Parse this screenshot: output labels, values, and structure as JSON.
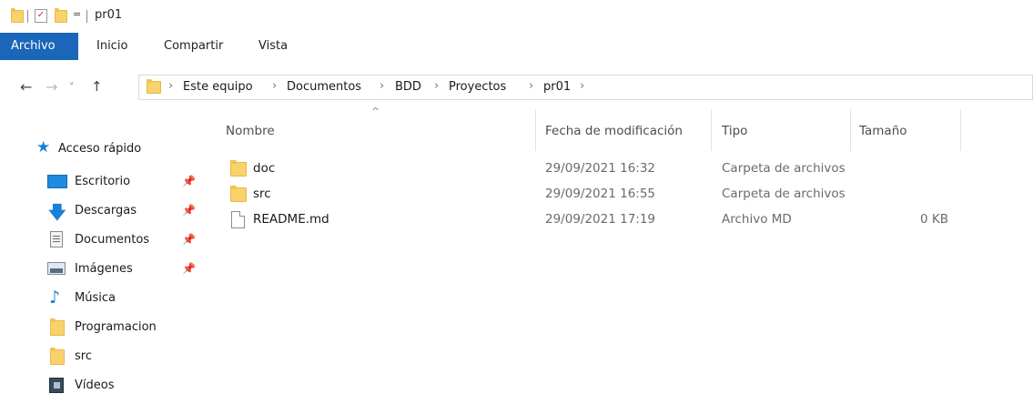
{
  "window": {
    "title": "pr01",
    "quick_access_dropdown": "="
  },
  "ribbon": {
    "tabs": [
      "Archivo",
      "Inicio",
      "Compartir",
      "Vista"
    ]
  },
  "address": {
    "back": "←",
    "forward": "→",
    "recent": "˅",
    "up": "↑",
    "separator": "›",
    "path": [
      "Este equipo",
      "Documentos",
      "BDD",
      "Proyectos",
      "pr01"
    ]
  },
  "sidebar": {
    "items": [
      {
        "label": "Acceso rápido",
        "icon": "star-icon",
        "color": "#1a7fd6"
      },
      {
        "label": "Escritorio",
        "icon": "desktop-icon",
        "pinned": true
      },
      {
        "label": "Descargas",
        "icon": "download-icon",
        "pinned": true
      },
      {
        "label": "Documentos",
        "icon": "document-icon",
        "pinned": true
      },
      {
        "label": "Imágenes",
        "icon": "image-icon",
        "pinned": true
      },
      {
        "label": "Música",
        "icon": "music-icon"
      },
      {
        "label": "Programacion",
        "icon": "folder-icon"
      },
      {
        "label": "src",
        "icon": "folder-icon"
      },
      {
        "label": "Vídeos",
        "icon": "video-icon"
      }
    ]
  },
  "file_list": {
    "columns": [
      "Nombre",
      "Fecha de modificación",
      "Tipo",
      "Tamaño"
    ],
    "sort_indicator": "^",
    "rows": [
      {
        "name": "doc",
        "modified": "29/09/2021 16:32",
        "type": "Carpeta de archivos",
        "size": "",
        "icon": "folder-icon"
      },
      {
        "name": "src",
        "modified": "29/09/2021 16:55",
        "type": "Carpeta de archivos",
        "size": "",
        "icon": "folder-icon"
      },
      {
        "name": "README.md",
        "modified": "29/09/2021 17:19",
        "type": "Archivo MD",
        "size": "0 KB",
        "icon": "file-icon"
      }
    ]
  },
  "colors": {
    "accent": "#1a66b8",
    "folder": "#f8d36b"
  }
}
